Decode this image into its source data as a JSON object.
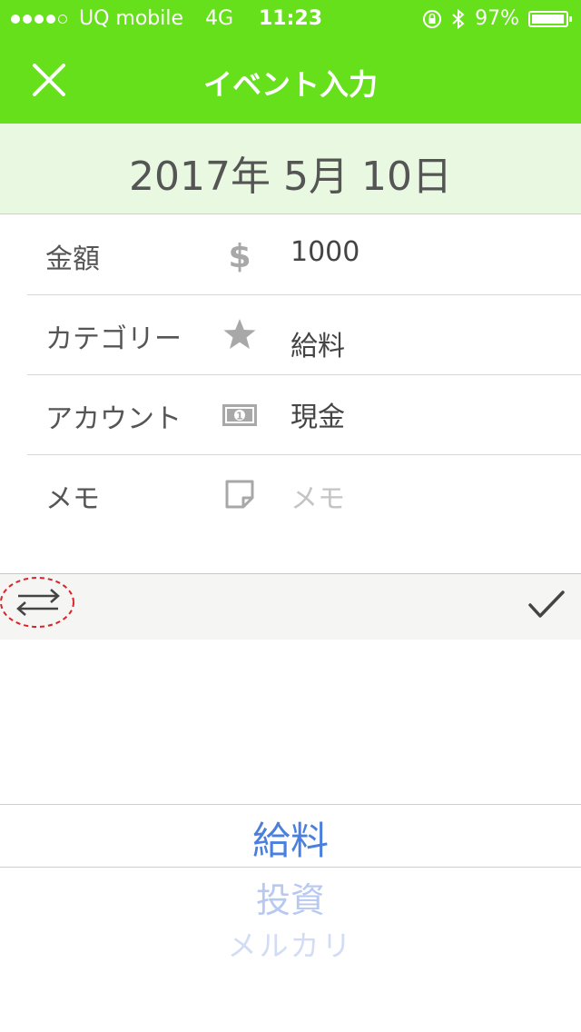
{
  "status_bar": {
    "carrier": "UQ mobile",
    "network": "4G",
    "time": "11:23",
    "battery": "97%",
    "battery_level": 0.97,
    "signal_bars": 4
  },
  "nav": {
    "title": "イベント入力"
  },
  "date": "2017年 5月 10日",
  "form": {
    "amount": {
      "label": "金額",
      "value": "1000"
    },
    "category": {
      "label": "カテゴリー",
      "value": "給料"
    },
    "account": {
      "label": "アカウント",
      "value": "現金"
    },
    "memo": {
      "label": "メモ",
      "placeholder": "メモ"
    }
  },
  "picker": {
    "selected": "給料",
    "options": [
      "給料",
      "投資",
      "メルカリ"
    ]
  },
  "colors": {
    "brand_green": "#66e01a",
    "date_band": "#e9f9e1",
    "picker_selected": "#4a7fdd"
  },
  "icons": [
    "close-icon",
    "dollar-icon",
    "star-icon",
    "banknote-icon",
    "note-icon",
    "swap-arrows-icon",
    "checkmark-icon"
  ]
}
